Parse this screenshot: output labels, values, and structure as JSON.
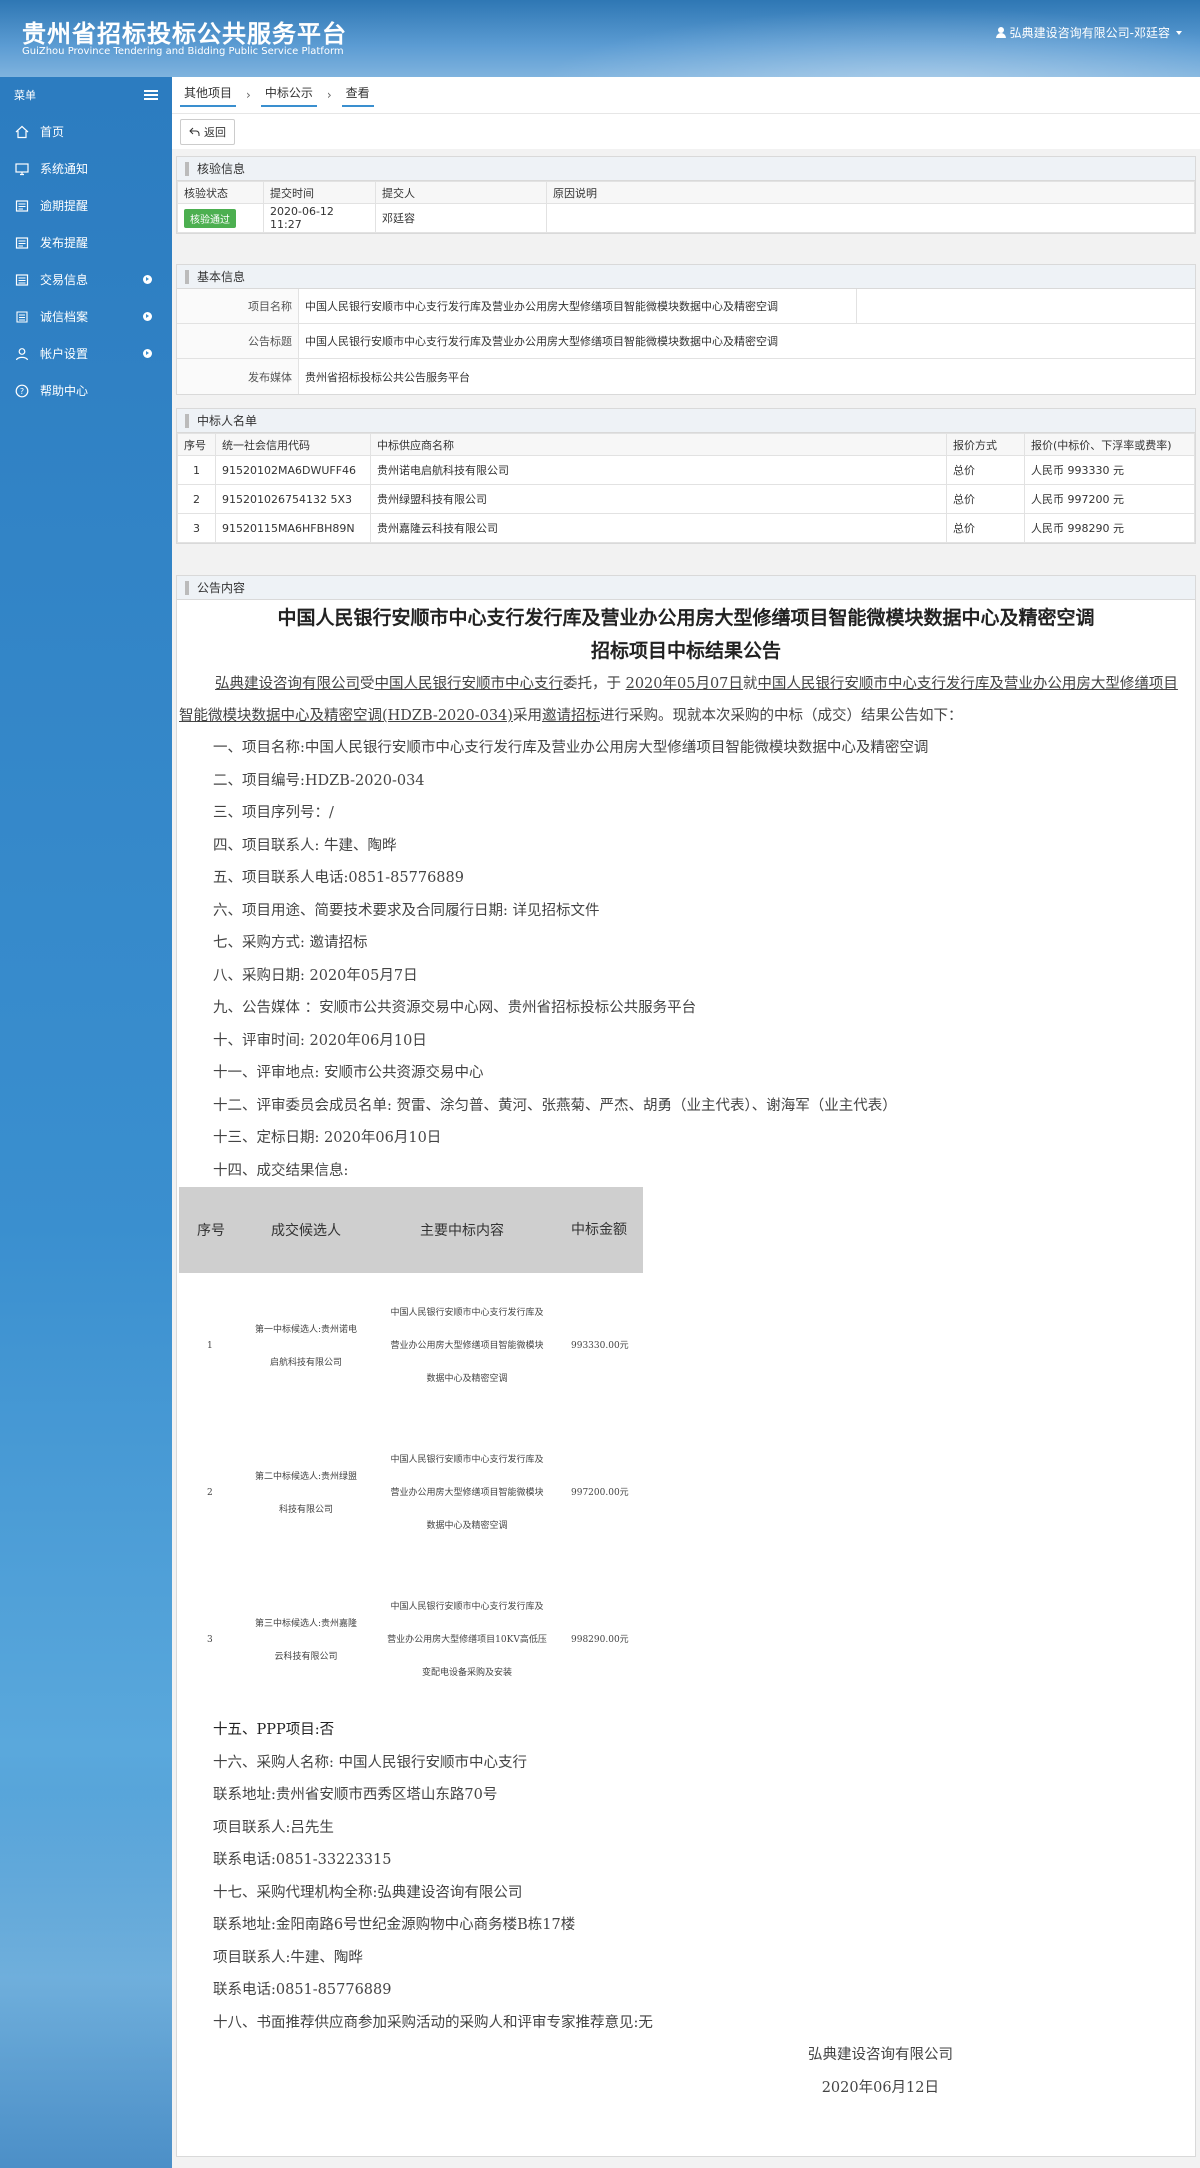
{
  "header": {
    "title_cn": "贵州省招标投标公共服务平台",
    "title_en": "GuiZhou Province Tendering and Bidding Public Service Platform",
    "user": "弘典建设咨询有限公司-邓廷容"
  },
  "sidebar": {
    "heading": "菜单",
    "items": [
      {
        "label": "首页",
        "icon": "home-icon",
        "has_children": false
      },
      {
        "label": "系统通知",
        "icon": "monitor-icon",
        "has_children": false
      },
      {
        "label": "逾期提醒",
        "icon": "notice-icon",
        "has_children": false
      },
      {
        "label": "发布提醒",
        "icon": "notice-icon",
        "has_children": false
      },
      {
        "label": "交易信息",
        "icon": "list-icon",
        "has_children": true
      },
      {
        "label": "诚信档案",
        "icon": "document-icon",
        "has_children": true
      },
      {
        "label": "帐户设置",
        "icon": "user-icon",
        "has_children": true
      },
      {
        "label": "帮助中心",
        "icon": "help-icon",
        "has_children": false
      }
    ]
  },
  "breadcrumb": [
    "其他项目",
    "中标公示",
    "查看"
  ],
  "toolbar": {
    "back_label": "返回"
  },
  "verify": {
    "title": "核验信息",
    "headers": [
      "核验状态",
      "提交时间",
      "提交人",
      "原因说明"
    ],
    "status": "核验通过",
    "submit_time": "2020-06-12 11:27",
    "submitter": "邓廷容",
    "reason": ""
  },
  "basic": {
    "title": "基本信息",
    "project_label": "项目名称",
    "project_value": "中国人民银行安顺市中心支行发行库及营业办公用房大型修缮项目智能微模块数据中心及精密空调",
    "notice_label": "公告标题",
    "notice_value": "中国人民银行安顺市中心支行发行库及营业办公用房大型修缮项目智能微模块数据中心及精密空调",
    "media_label": "发布媒体",
    "media_value": "贵州省招标投标公共公告服务平台"
  },
  "winners": {
    "title": "中标人名单",
    "headers": [
      "序号",
      "统一社会信用代码",
      "中标供应商名称",
      "报价方式",
      "报价(中标价、下浮率或费率)"
    ],
    "rows": [
      [
        "1",
        "91520102MA6DWUFF46",
        "贵州诺电启航科技有限公司",
        "总价",
        "人民币 993330 元"
      ],
      [
        "2",
        "915201026754132 5X3",
        "贵州绿盟科技有限公司",
        "总价",
        "人民币 997200 元"
      ],
      [
        "3",
        "91520115MA6HFBH89N",
        "贵州嘉隆云科技有限公司",
        "总价",
        "人民币 998290 元"
      ]
    ]
  },
  "announcement": {
    "panel_title": "公告内容",
    "title_line1": "中国人民银行安顺市中心支行发行库及营业办公用房大型修缮项目智能微模块数据中心及精密空调",
    "title_line2": "招标项目中标结果公告",
    "intro": {
      "agent": "弘典建设咨询有限公司",
      "t1": "受",
      "client": "中国人民银行安顺市中心支行",
      "t2": "委托，于",
      "date": "2020年05月07日",
      "t3": "就",
      "project": "中国人民银行安顺市中心支行发行库及营业办公用房大型修缮项目智能微模块数据中心及精密空调(HDZB-2020-034)",
      "t4": "采用",
      "method": "邀请招标",
      "t5": "进行采购。现就本次采购的中标（成交）结果公告如下："
    },
    "items": [
      "一、项目名称:中国人民银行安顺市中心支行发行库及营业办公用房大型修缮项目智能微模块数据中心及精密空调",
      "二、项目编号:HDZB-2020-034",
      "三、项目序列号：/",
      "四、项目联系人: 牛建、陶晔",
      "五、项目联系人电话:0851-85776889",
      "六、项目用途、简要技术要求及合同履行日期: 详见招标文件",
      "七、采购方式: 邀请招标",
      "八、采购日期: 2020年05月7日",
      "九、公告媒体 ：安顺市公共资源交易中心网、贵州省招标投标公共服务平台",
      "十、评审时间: 2020年06月10日",
      "十一、评审地点: 安顺市公共资源交易中心",
      "十二、评审委员会成员名单: 贺雷、涂匀普、黄河、张燕菊、严杰、胡勇（业主代表）、谢海军（业主代表）",
      "十三、定标日期: 2020年06月10日",
      "十四、成交结果信息:"
    ],
    "result_headers": [
      "序号",
      "成交候选人",
      "主要中标内容",
      "中标金额"
    ],
    "result_rows": [
      {
        "no": "1",
        "candidate": "第一中标候选人:贵州诺电启航科技有限公司",
        "content": "中国人民银行安顺市中心支行发行库及营业办公用房大型修缮项目智能微模块数据中心及精密空调",
        "amount": "993330.00元"
      },
      {
        "no": "2",
        "candidate": "第二中标候选人:贵州绿盟科技有限公司",
        "content": "中国人民银行安顺市中心支行发行库及营业办公用房大型修缮项目智能微模块数据中心及精密空调",
        "amount": "997200.00元"
      },
      {
        "no": "3",
        "candidate": "第三中标候选人:贵州嘉隆云科技有限公司",
        "content": "中国人民银行安顺市中心支行发行库及营业办公用房大型修缮项目10KV高低压变配电设备采购及安装",
        "amount": "998290.00元"
      }
    ],
    "tail": [
      "十五、PPP项目:否",
      "十六、采购人名称: 中国人民银行安顺市中心支行",
      "联系地址:贵州省安顺市西秀区塔山东路70号",
      "项目联系人:吕先生",
      "联系电话:0851-33223315",
      "十七、采购代理机构全称:弘典建设咨询有限公司",
      "联系地址:金阳南路6号世纪金源购物中心商务楼B栋17楼",
      "项目联系人:牛建、陶晔",
      "联系电话:0851-85776889",
      "十八、书面推荐供应商参加采购活动的采购人和评审专家推荐意见:无"
    ],
    "sign_company": "弘典建设咨询有限公司",
    "sign_date": "2020年06月12日"
  }
}
